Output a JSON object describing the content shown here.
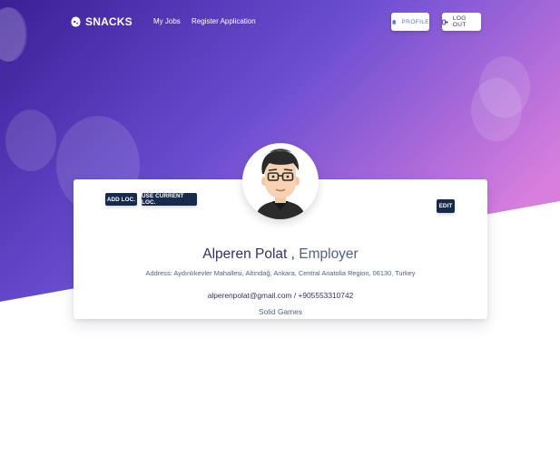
{
  "brand": {
    "name": "SNACKS",
    "logo_icon": "snacks-logo-icon"
  },
  "nav": {
    "links": [
      "My Jobs",
      "Register Application"
    ],
    "profile_label": "PROFILE",
    "profile_icon": "bell-icon",
    "logout_label": "LOG OUT",
    "logout_icon": "logout-icon"
  },
  "card": {
    "add_loc_label": "ADD LOC.",
    "use_current_loc_label": "USE CURRENT LOC.",
    "edit_label": "EDIT",
    "name": "Alperen Polat",
    "separator": " , ",
    "role": "Employer",
    "address": "Address: Aydınlıkevler Mahallesi, Altındağ, Ankara, Central Anatolia Region, 06130, Turkey",
    "contact": "alperenpolat@gmail.com / +905553310742",
    "company": "Solid Games"
  },
  "colors": {
    "gradient_start": "#3a1f96",
    "gradient_mid": "#6a4ed1",
    "gradient_end": "#d77ede",
    "dark_button": "#172b4d",
    "accent": "#5e72e4"
  }
}
